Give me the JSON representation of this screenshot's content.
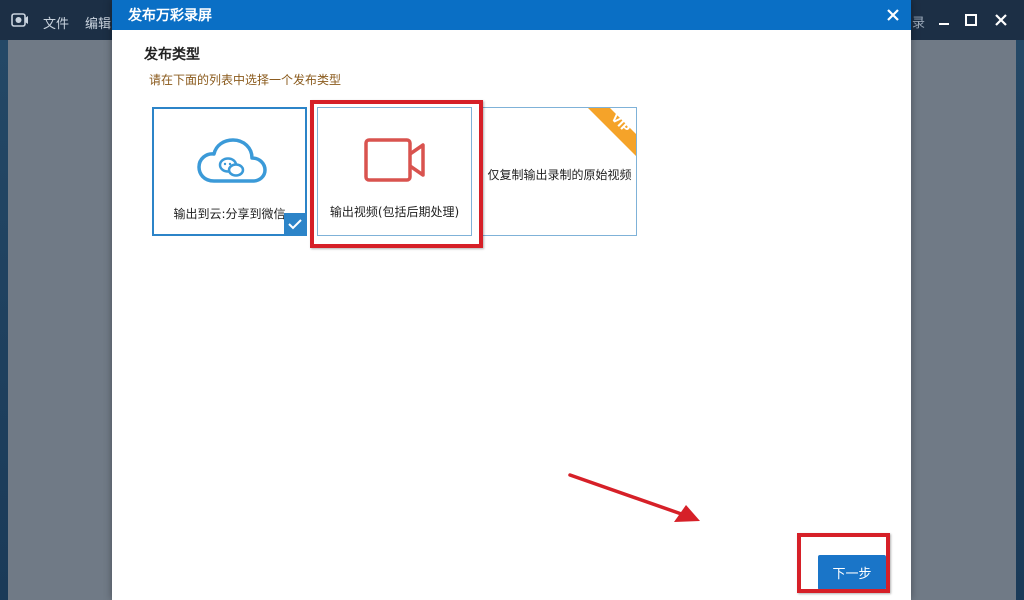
{
  "background_app": {
    "menu_items": [
      "文件",
      "编辑"
    ],
    "partial_text": "录",
    "icons": [
      "app-logo-icon",
      "minimize-icon",
      "maximize-icon",
      "close-icon"
    ]
  },
  "dialog": {
    "title": "发布万彩录屏",
    "section_title": "发布类型",
    "section_hint": "请在下面的列表中选择一个发布类型",
    "options": [
      {
        "label": "输出到云:分享到微信",
        "icon": "cloud-share-icon",
        "selected": true
      },
      {
        "label": "输出视频(包括后期处理)",
        "icon": "video-camera-icon",
        "selected": false
      },
      {
        "label": "仅复制输出录制的原始视频",
        "icon": "",
        "selected": false,
        "badge": "VIP"
      }
    ],
    "next_button": "下一步"
  },
  "colors": {
    "titlebar": "#0a6fc5",
    "accent": "#2c84c8",
    "annotation_red": "#d62028",
    "vip_orange": "#f5a329",
    "video_icon_red": "#d9534f",
    "cloud_icon_blue": "#3b9ad8"
  }
}
